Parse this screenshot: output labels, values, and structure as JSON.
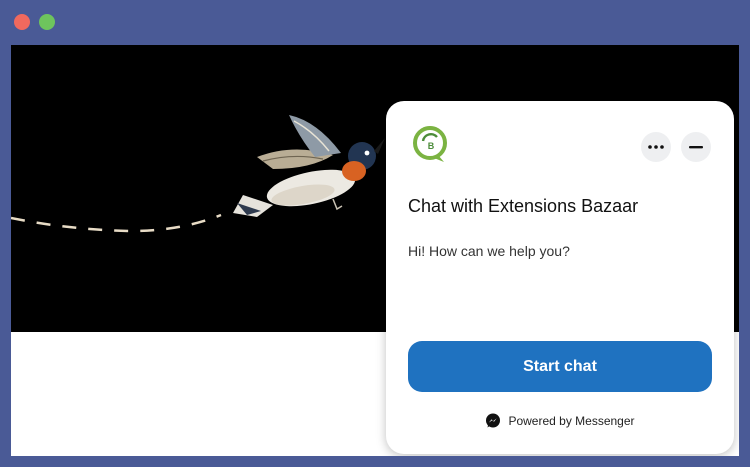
{
  "window": {
    "controls": [
      "close",
      "maximize"
    ],
    "colors": {
      "close": "#f0695e",
      "maximize": "#6ec45d",
      "frame": "#4a5a96"
    }
  },
  "hero": {
    "background": "#000000",
    "illustration": "hummingbird-icon",
    "trail": "dashed-line"
  },
  "chat": {
    "logo": "extensions-bazaar-logo",
    "more_icon": "more-icon",
    "minimize_icon": "minimize-icon",
    "title": "Chat with Extensions Bazaar",
    "greeting": "Hi! How can we help you?",
    "start_label": "Start chat",
    "powered_by": "Powered by Messenger",
    "messenger_icon": "messenger-icon",
    "accent": "#1f72c0"
  }
}
